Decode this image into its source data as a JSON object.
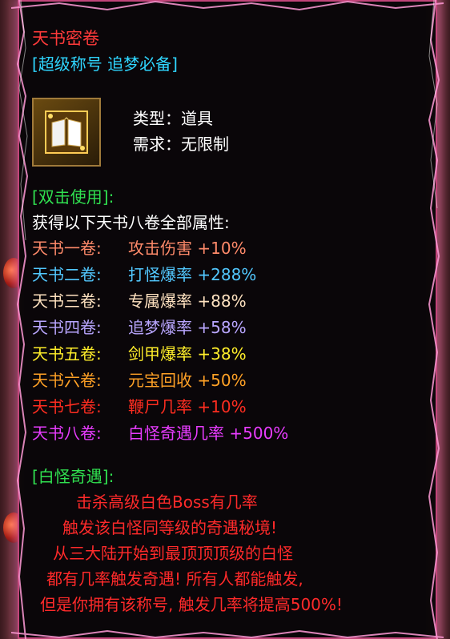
{
  "item": {
    "name": "天书密卷",
    "title_tag": "[超级称号 追梦必备]",
    "type_line": "类型：道具",
    "req_line": "需求：无限制"
  },
  "usage": {
    "header": "[双击使用]:",
    "intro": "获得以下天书八卷全部属性:",
    "volumes": [
      {
        "label": "天书一卷:",
        "effect": "攻击伤害 +10%",
        "color": "#ff8a6a"
      },
      {
        "label": "天书二卷:",
        "effect": "打怪爆率 +288%",
        "color": "#52c8ff"
      },
      {
        "label": "天书三卷:",
        "effect": "专属爆率 +88%",
        "color": "#ffe2c0"
      },
      {
        "label": "天书四卷:",
        "effect": "追梦爆率 +58%",
        "color": "#b9a6ff"
      },
      {
        "label": "天书五卷:",
        "effect": "剑甲爆率 +38%",
        "color": "#ffee2a"
      },
      {
        "label": "天书六卷:",
        "effect": "元宝回收 +50%",
        "color": "#ffa126"
      },
      {
        "label": "天书七卷:",
        "effect": "鞭尸几率 +10%",
        "color": "#ff2d20"
      },
      {
        "label": "天书八卷:",
        "effect": "白怪奇遇几率 +500%",
        "color": "#e83cff"
      }
    ]
  },
  "encounter": {
    "header": "[白怪奇遇]:",
    "lines": [
      "击杀高级白色Boss有几率",
      "触发该白怪同等级的奇遇秘境!",
      "从三大陆开始到最顶顶顶级的白怪",
      "都有几率触发奇遇! 所有人都能触发,",
      "但是你拥有该称号, 触发几率将提高500%!"
    ]
  }
}
